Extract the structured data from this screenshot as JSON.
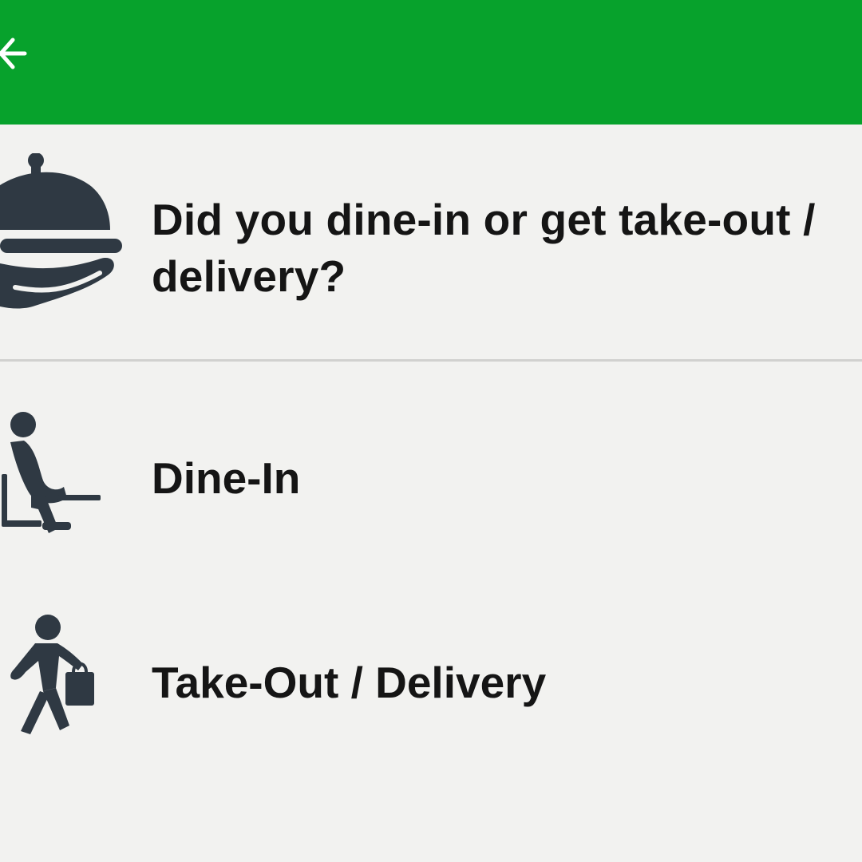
{
  "app_bar": {
    "background_color": "#07a22c",
    "back_icon": "arrow-left-icon"
  },
  "question": {
    "icon": "serving-cloche-icon",
    "text": "Did you dine-in or get take-out / delivery?"
  },
  "options": [
    {
      "label": "Dine-In",
      "icon": "person-seated-at-table-icon"
    },
    {
      "label": "Take-Out / Delivery",
      "icon": "person-walking-with-bag-icon"
    }
  ],
  "colors": {
    "icon": "#2f3943",
    "text": "#151515",
    "background": "#f2f2f0"
  }
}
